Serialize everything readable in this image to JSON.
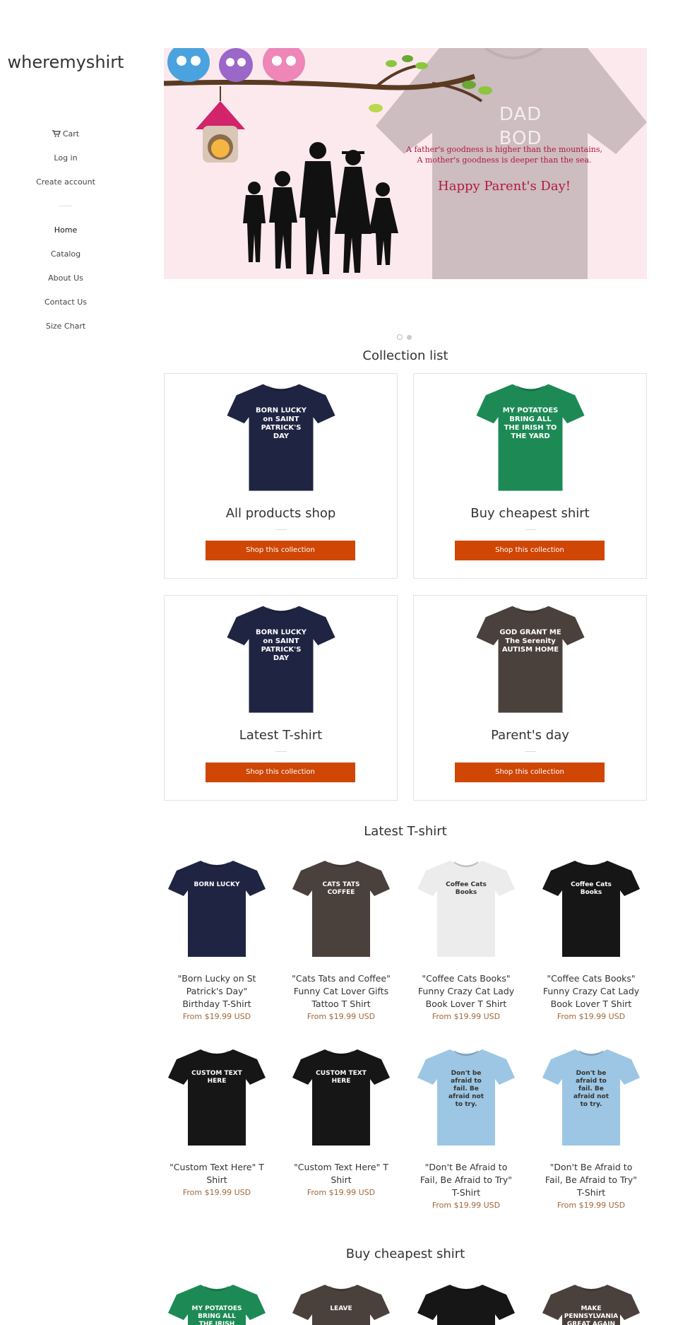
{
  "store": {
    "name": "wheremyshirt"
  },
  "account_nav": {
    "cart": "Cart",
    "login": "Log in",
    "create_account": "Create account"
  },
  "main_nav": [
    "Home",
    "Catalog",
    "About Us",
    "Contact Us",
    "Size Chart"
  ],
  "hero": {
    "shirt_text": "DAD BOD",
    "line1": "A father's goodness is higher than the mountains,",
    "line2": "A mother's goodness is deeper than the sea.",
    "headline": "Happy Parent's Day!",
    "slides": 2,
    "active_slide": 1
  },
  "collection_list": {
    "title": "Collection list",
    "items": [
      {
        "name": "All products shop",
        "button": "Shop this collection",
        "shirt_color": "#1f2442",
        "art": "BORN LUCKY on SAINT PATRICK'S DAY"
      },
      {
        "name": "Buy cheapest shirt",
        "button": "Shop this collection",
        "shirt_color": "#1d8a55",
        "art": "MY POTATOES BRING ALL THE IRISH TO THE YARD"
      },
      {
        "name": "Latest T-shirt",
        "button": "Shop this collection",
        "shirt_color": "#1f2442",
        "art": "BORN LUCKY on SAINT PATRICK'S DAY"
      },
      {
        "name": "Parent's day",
        "button": "Shop this collection",
        "shirt_color": "#4a403c",
        "art": "GOD GRANT ME The Serenity AUTISM HOME"
      }
    ]
  },
  "latest": {
    "title": "Latest T-shirt",
    "products": [
      {
        "title": "\"Born Lucky on St Patrick's Day\" Birthday T-Shirt",
        "price": "From $19.99 USD",
        "shirt_color": "#1f2442",
        "art": "BORN LUCKY"
      },
      {
        "title": "\"Cats Tats and Coffee\" Funny Cat Lover Gifts Tattoo T Shirt",
        "price": "From $19.99 USD",
        "shirt_color": "#4a403c",
        "art": "CATS TATS COFFEE"
      },
      {
        "title": "\"Coffee Cats Books\" Funny Crazy Cat Lady Book Lover T Shirt",
        "price": "From $19.99 USD",
        "shirt_color": "#ececec",
        "art": "Coffee Cats Books"
      },
      {
        "title": "\"Coffee Cats Books\" Funny Crazy Cat Lady Book Lover T Shirt",
        "price": "From $19.99 USD",
        "shirt_color": "#161616",
        "art": "Coffee Cats Books"
      },
      {
        "title": "\"Custom Text Here\" T Shirt",
        "price": "From $19.99 USD",
        "shirt_color": "#161616",
        "art": "CUSTOM TEXT HERE"
      },
      {
        "title": "\"Custom Text Here\" T Shirt",
        "price": "From $19.99 USD",
        "shirt_color": "#161616",
        "art": "CUSTOM TEXT HERE"
      },
      {
        "title": "\"Don't Be Afraid to Fail, Be Afraid to Try\" T-Shirt",
        "price": "From $19.99 USD",
        "shirt_color": "#9cc6e4",
        "art": "Don't be afraid to fail. Be afraid not to try."
      },
      {
        "title": "\"Don't Be Afraid to Fail, Be Afraid to Try\" T-Shirt",
        "price": "From $19.99 USD",
        "shirt_color": "#9cc6e4",
        "art": "Don't be afraid to fail. Be afraid not to try."
      }
    ]
  },
  "cheapest": {
    "title": "Buy cheapest shirt",
    "shirts": [
      {
        "shirt_color": "#1d8a55",
        "art": "MY POTATOES BRING ALL THE IRISH"
      },
      {
        "shirt_color": "#4a403c",
        "art": "LEAVE"
      },
      {
        "shirt_color": "#161616",
        "art": ""
      },
      {
        "shirt_color": "#4a403c",
        "art": "MAKE PENNSYLVANIA GREAT AGAIN"
      }
    ]
  },
  "colors": {
    "accent": "#cf4605",
    "price": "#a0683a",
    "hero_text": "#b2183f"
  }
}
